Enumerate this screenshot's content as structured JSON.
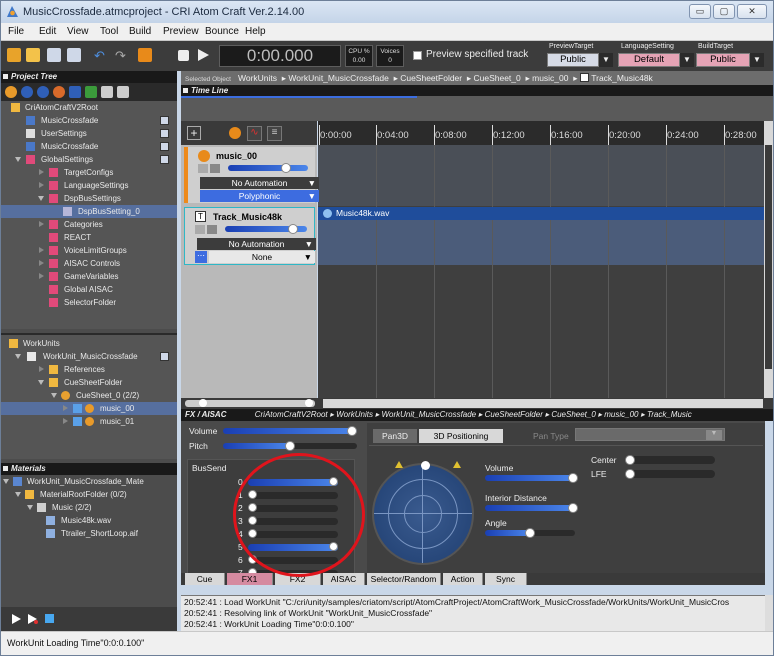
{
  "window": {
    "title": "MusicCrossfade.atmcproject - CRI Atom Craft Ver.2.14.00",
    "btn_min": "▭",
    "btn_max": "▢",
    "btn_close": "✕"
  },
  "menu": [
    "File",
    "Edit",
    "View",
    "Tool",
    "Build",
    "Preview",
    "Bounce",
    "Help"
  ],
  "toolbar": {
    "time": "0:00.000",
    "cpu_label": "CPU %",
    "cpu_value": "0.00",
    "voices_label": "Voices",
    "voices_value": "0",
    "preview_specified": "Preview specified track",
    "preview_target_label": "PreviewTarget",
    "preview_target_value": "Public",
    "language_label": "LanguageSetting",
    "language_value": "Default",
    "build_label": "BuildTarget",
    "build_value": "Public"
  },
  "project_tree": {
    "header": "Project Tree",
    "items": [
      {
        "label": "CriAtomCraftV2Root"
      },
      {
        "label": "MusicCrossfade"
      },
      {
        "label": "UserSettings"
      },
      {
        "label": "MusicCrossfade"
      },
      {
        "label": "GlobalSettings"
      },
      {
        "label": "TargetConfigs"
      },
      {
        "label": "LanguageSettings"
      },
      {
        "label": "DspBusSettings"
      },
      {
        "label": "DspBusSetting_0"
      },
      {
        "label": "Categories"
      },
      {
        "label": "REACT"
      },
      {
        "label": "VoiceLimitGroups"
      },
      {
        "label": "AISAC Controls"
      },
      {
        "label": "GameVariables"
      },
      {
        "label": "Global AISAC"
      },
      {
        "label": "SelectorFolder"
      }
    ]
  },
  "workunits": {
    "items": [
      {
        "label": "WorkUnits"
      },
      {
        "label": "WorkUnit_MusicCrossfade"
      },
      {
        "label": "References"
      },
      {
        "label": "CueSheetFolder"
      },
      {
        "label": "CueSheet_0  (2/2)"
      },
      {
        "label": "music_00"
      },
      {
        "label": "music_01"
      }
    ]
  },
  "materials": {
    "header": "Materials",
    "items": [
      {
        "label": "WorkUnit_MusicCrossfade_Mate"
      },
      {
        "label": "MaterialRootFolder  (0/2)"
      },
      {
        "label": "Music  (2/2)"
      },
      {
        "label": "Music48k.wav"
      },
      {
        "label": "Ttrailer_ShortLoop.aif"
      }
    ]
  },
  "selected_object": {
    "label": "Selected Object",
    "path": [
      "WorkUnits",
      "WorkUnit_MusicCrossfade",
      "CueSheetFolder",
      "CueSheet_0",
      "music_00",
      "Track_Music48k"
    ]
  },
  "timeline": {
    "header": "Time Line",
    "ticks": [
      "0:00:00",
      "0:04:00",
      "0:08:00",
      "0:12:00",
      "0:16:00",
      "0:20:00",
      "0:24:00",
      "0:28:00"
    ],
    "track1": {
      "name": "music_00",
      "automation": "No Automation",
      "mode": "Polyphonic",
      "volume": 0.75
    },
    "track2": {
      "name": "Track_Music48k",
      "automation": "No Automation",
      "select": "None",
      "volume": 0.88
    },
    "clip_label": "Music48k.wav"
  },
  "fx": {
    "header": "FX / AISAC",
    "path": "CriAtomCraftV2Root ▸ WorkUnits ▸ WorkUnit_MusicCrossfade ▸ CueSheetFolder ▸ CueSheet_0 ▸ music_00 ▸ Track_Music",
    "volume_label": "Volume",
    "pitch_label": "Pitch",
    "volume_value": 1.0,
    "pitch_value": 0.5,
    "bussend_label": "BusSend",
    "buses": [
      {
        "label": "0",
        "value": 1.0
      },
      {
        "label": "1",
        "value": 0.0
      },
      {
        "label": "2",
        "value": 0.0
      },
      {
        "label": "3",
        "value": 0.0
      },
      {
        "label": "4",
        "value": 0.0
      },
      {
        "label": "5",
        "value": 1.0
      },
      {
        "label": "6",
        "value": 0.0
      },
      {
        "label": "7",
        "value": 0.0
      }
    ],
    "tab_pan3d": "Pan3D",
    "tab_3dpos": "3D Positioning",
    "pan_type_label": "Pan Type",
    "pan_volume_label": "Volume",
    "interior_label": "Interior Distance",
    "angle_label": "Angle",
    "center_label": "Center",
    "lfe_label": "LFE",
    "pan_volume": 1.0,
    "interior_value": 1.0,
    "angle_value": 0.5,
    "center_value": 0.0,
    "lfe_value": 0.0
  },
  "bottom_tabs": [
    "Cue",
    "FX1",
    "FX2",
    "AISAC",
    "Selector/Random",
    "Action",
    "Sync"
  ],
  "log": [
    "20:52:41 :  Load WorkUnit \"C:/cri/unity/samples/criatom/script/AtomCraftProject/AtomCraftWork_MusicCrossfade/WorkUnits/WorkUnit_MusicCros",
    "20:52:41 :  Resolving link of WorkUnit \"WorkUnit_MusicCrossfade\"",
    "20:52:41 :  WorkUnit Loading Time\"0:0:0.100\""
  ],
  "status": "WorkUnit Loading Time\"0:0:0.100\""
}
